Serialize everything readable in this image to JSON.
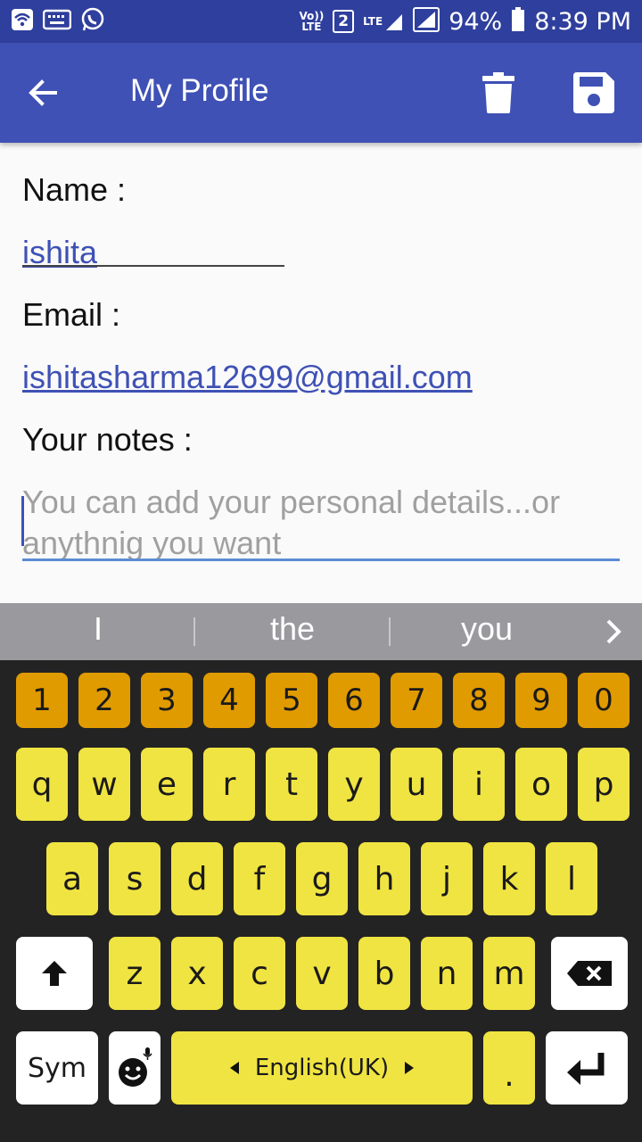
{
  "status_bar": {
    "icons": [
      "wifi-icon",
      "keyboard-icon",
      "whatsapp-icon"
    ],
    "volte_top": "Vo))",
    "volte_bottom": "LTE",
    "sim": "2",
    "lte": "LTE",
    "battery": "94%",
    "time": "8:39 PM"
  },
  "app_bar": {
    "title": "My Profile",
    "back_icon": "arrow-back-icon",
    "delete_icon": "delete-icon",
    "save_icon": "save-icon",
    "color": "#3f51b5"
  },
  "form": {
    "name_label": "Name :",
    "name_value": "ishita",
    "email_label": "Email :",
    "email_value": "ishitasharma12699@gmail.com",
    "notes_label": "Your notes :",
    "notes_placeholder": "You can add your personal details...or anythnig you want"
  },
  "suggestions": [
    "I",
    "the",
    "you"
  ],
  "keyboard": {
    "numbers": [
      "1",
      "2",
      "3",
      "4",
      "5",
      "6",
      "7",
      "8",
      "9",
      "0"
    ],
    "row1": [
      "q",
      "w",
      "e",
      "r",
      "t",
      "y",
      "u",
      "i",
      "o",
      "p"
    ],
    "row2": [
      "a",
      "s",
      "d",
      "f",
      "g",
      "h",
      "j",
      "k",
      "l"
    ],
    "row3": [
      "z",
      "x",
      "c",
      "v",
      "b",
      "n",
      "m"
    ],
    "sym_label": "Sym",
    "space_label": "English(UK)",
    "period_label": ".",
    "key_color": "#f0e442",
    "number_key_color": "#e09b00"
  }
}
